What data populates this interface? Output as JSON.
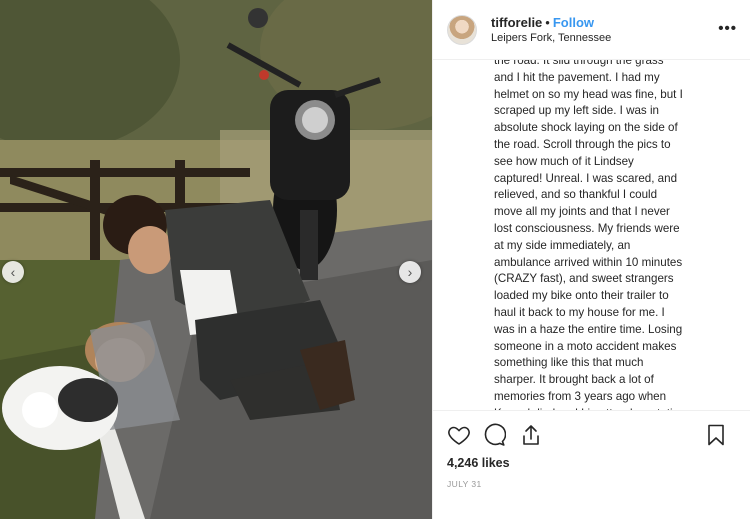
{
  "post": {
    "photo": {
      "description_icon": "photo-image",
      "prev_icon": "chevron-left-icon",
      "next_icon": "chevron-right-icon"
    },
    "header": {
      "username": "tifforelie",
      "separator": "•",
      "follow_label": "Follow",
      "location": "Leipers Fork, Tennessee",
      "more_label": "•••"
    },
    "caption_lines": [
      "the road. It slid through the grass",
      "and I hit the pavement. I had my",
      "helmet on so my head was fine, but I",
      "scraped up my left side. I was in",
      "absolute shock laying on the side of",
      "the road. Scroll through the pics to",
      "see how much of it Lindsey",
      "captured! Unreal. I was scared, and",
      "relieved, and so thankful I could",
      "move all my joints and that I never",
      "lost consciousness. My friends were",
      "at my side immediately, an",
      "ambulance arrived within 10 minutes",
      "(CRAZY fast), and sweet strangers",
      "loaded my bike onto their trailer to",
      "haul it back to my house for me. I",
      "was in a haze the entire time. Losing",
      "someone in a moto accident makes",
      "something like this that much",
      "sharper. It brought back a lot of",
      "memories from 3 years ago when",
      "Kennel died and I in utter devastation"
    ],
    "actions": {
      "like_icon": "heart-icon",
      "comment_icon": "comment-icon",
      "share_icon": "share-icon",
      "save_icon": "bookmark-icon"
    },
    "likes": "4,246 likes",
    "date": "JULY 31"
  },
  "colors": {
    "follow_blue": "#3897f0",
    "text": "#262626",
    "muted": "#999999",
    "divider": "#efefef"
  }
}
